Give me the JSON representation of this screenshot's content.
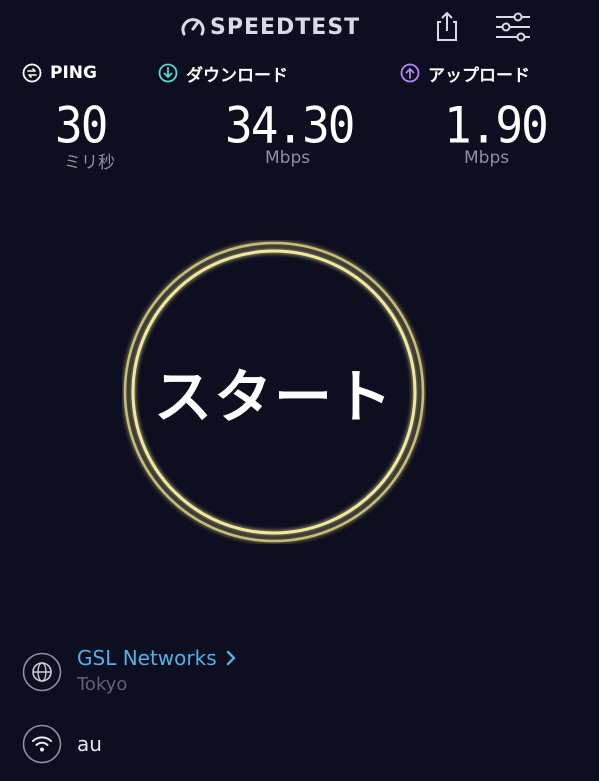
{
  "header": {
    "logo_text": "SPEEDTEST",
    "logo_icon": "gauge-icon",
    "share_icon": "share-icon",
    "settings_icon": "sliders-icon"
  },
  "metrics": {
    "ping": {
      "label": "PING",
      "value": "30",
      "unit": "ミリ秒",
      "icon": "ping-icon",
      "color": "#ffffff"
    },
    "download": {
      "label": "ダウンロード",
      "value": "34.30",
      "unit": "Mbps",
      "icon": "download-icon",
      "color": "#5ad7d3"
    },
    "upload": {
      "label": "アップロード",
      "value": "1.90",
      "unit": "Mbps",
      "icon": "upload-icon",
      "color": "#b488f5"
    }
  },
  "start_button": {
    "label": "スタート",
    "ring_color": "#e9dc86"
  },
  "server": {
    "name": "GSL Networks",
    "location": "Tokyo",
    "icon": "globe-icon",
    "link_color": "#4fb3e8"
  },
  "provider": {
    "name": "au",
    "icon": "wifi-icon"
  }
}
